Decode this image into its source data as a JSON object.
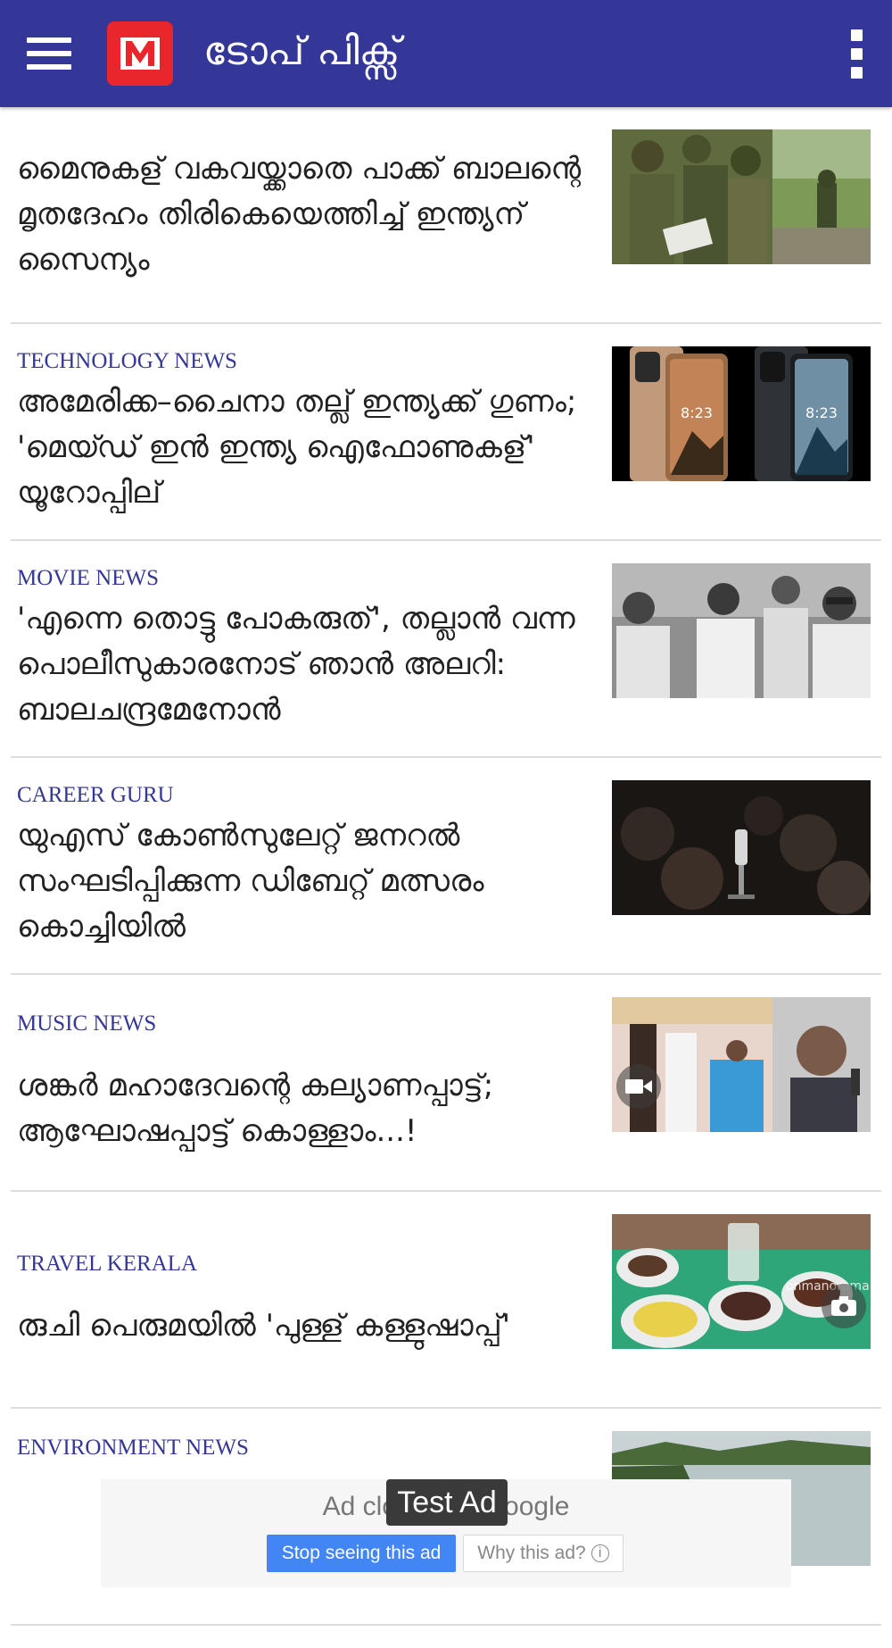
{
  "appbar": {
    "title": "ടോപ് പിക്സ്",
    "menu_icon": "hamburger-menu-icon",
    "logo_icon": "manorama-m-logo",
    "overflow_icon": "more-vertical-icon",
    "color": "#343797"
  },
  "feed": {
    "items": [
      {
        "category": "",
        "headline": "മൈനുകള് വകവയ്ക്കാതെ പാക്ക് ബാലന്റെ  മൃതദേഹം തിരികെയെത്തിച്ച് ഇന്ത്യന് സൈന്യം",
        "thumb": "soldiers-photo"
      },
      {
        "category": "TECHNOLOGY NEWS",
        "headline": "അമേരിക്ക–ചൈനാ തല്ല് ഇന്ത്യക്ക് ഗുണം; 'മെയ്ഡ് ഇൻ ഇന്ത്യ ഐഫോണുകള്' യൂറോപ്പില്",
        "thumb": "iphones-photo"
      },
      {
        "category": "MOVIE NEWS",
        "headline": "'എന്നെ തൊട്ടു പോകരുത്', തല്ലാൻ വന്ന പൊലീസുകാരനോട് ഞാൻ അലറി: ബാലചന്ദ്രമേനോൻ",
        "thumb": "black-white-group-photo"
      },
      {
        "category": "CAREER GURU",
        "headline": "യുഎസ് കോൺസുലേറ്റ് ജനറൽ സംഘടിപ്പിക്കുന്ന ഡിബേറ്റ് മത്സരം കൊച്ചിയിൽ",
        "thumb": "microphone-photo"
      },
      {
        "category": "MUSIC NEWS",
        "headline": "ശങ്കർ മഹാദേവന്റെ കല്യാണപ്പാട്ട്; ആഘോഷപ്പാട്ട് കൊള്ളാം...!",
        "thumb": "wedding-singer-photo",
        "badge": "video-camera-icon"
      },
      {
        "category": "TRAVEL KERALA",
        "headline": "രുചി പെരുമയിൽ 'പുള്ള് കള്ളുഷാപ്പ്'",
        "thumb": "toddy-shop-food-photo",
        "badge": "camera-icon",
        "watermark": "onmanorama"
      },
      {
        "category": "ENVIRONMENT NEWS",
        "headline": "",
        "thumb": "river-photo"
      }
    ]
  },
  "ad": {
    "closed_text": "Ad closed by Google",
    "test_label": "Test Ad",
    "stop_label": "Stop seeing this ad",
    "why_label": "Why this ad?",
    "info_glyph": "i"
  }
}
